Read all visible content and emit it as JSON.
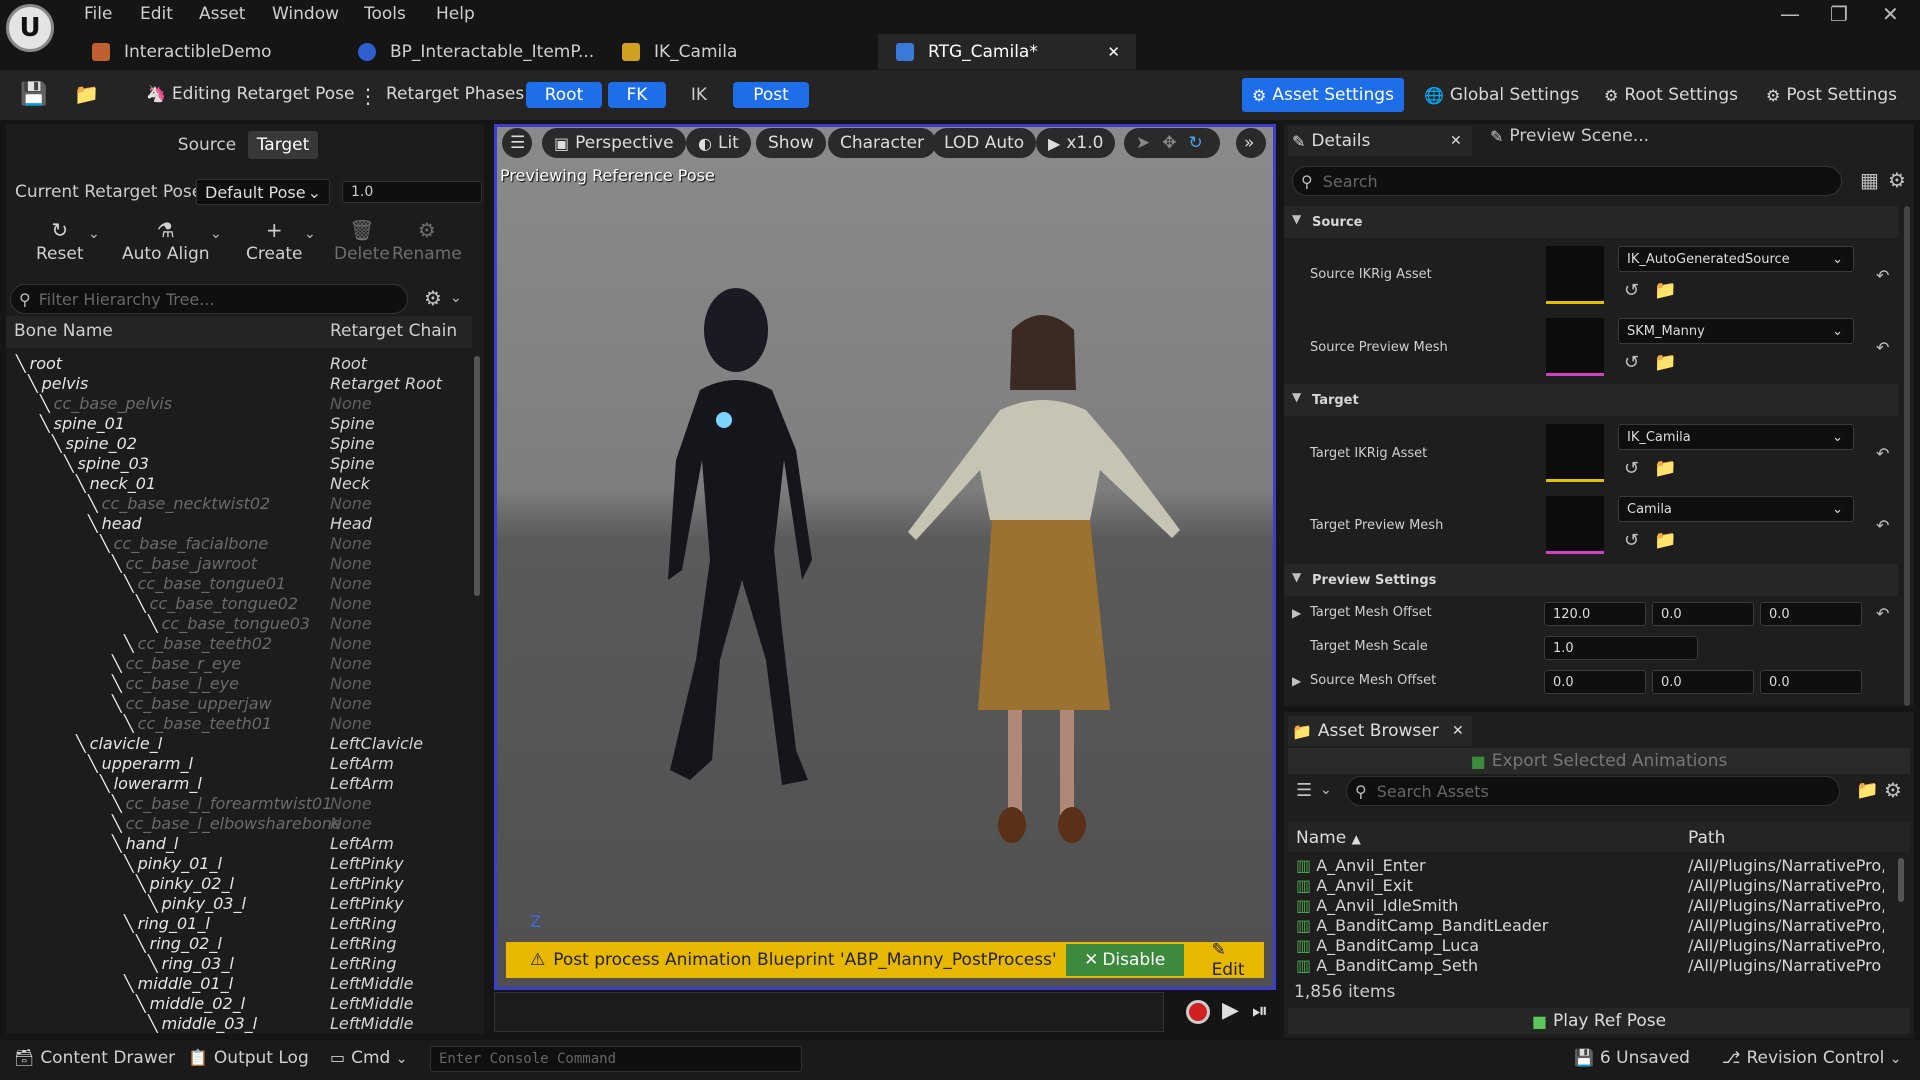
{
  "menu": {
    "file": "File",
    "edit": "Edit",
    "asset": "Asset",
    "window": "Window",
    "tools": "Tools",
    "help": "Help"
  },
  "tabs": [
    {
      "label": "InteractibleDemo",
      "color": "#c06030"
    },
    {
      "label": "BP_Interactable_ItemP...",
      "color": "#3060d0"
    },
    {
      "label": "IK_Camila",
      "color": "#d0a020"
    },
    {
      "label": "RTG_Camila*",
      "color": "#3a7ad8"
    }
  ],
  "toolbar": {
    "mode": "Editing Retarget Pose",
    "phases_label": "Retarget Phases:",
    "phases": [
      "Root",
      "FK",
      "IK",
      "Post"
    ],
    "asset_settings": "Asset Settings",
    "global_settings": "Global Settings",
    "root_settings": "Root Settings",
    "post_settings": "Post Settings"
  },
  "left": {
    "source_tab": "Source",
    "target_tab": "Target",
    "pose_label": "Current Retarget Pose:",
    "pose_value": "Default Pose",
    "blend_value": "1.0",
    "reset": "Reset",
    "auto_align": "Auto Align",
    "create": "Create",
    "delete": "Delete",
    "rename": "Rename",
    "filter_placeholder": "Filter Hierarchy Tree...",
    "col_bone": "Bone Name",
    "col_chain": "Retarget Chain",
    "bones": [
      {
        "name": "root",
        "chain": "Root",
        "depth": 0,
        "dim": false
      },
      {
        "name": "pelvis",
        "chain": "Retarget Root",
        "depth": 1,
        "dim": false
      },
      {
        "name": "cc_base_pelvis",
        "chain": "None",
        "depth": 2,
        "dim": true
      },
      {
        "name": "spine_01",
        "chain": "Spine",
        "depth": 2,
        "dim": false
      },
      {
        "name": "spine_02",
        "chain": "Spine",
        "depth": 3,
        "dim": false
      },
      {
        "name": "spine_03",
        "chain": "Spine",
        "depth": 4,
        "dim": false
      },
      {
        "name": "neck_01",
        "chain": "Neck",
        "depth": 5,
        "dim": false
      },
      {
        "name": "cc_base_necktwist02",
        "chain": "None",
        "depth": 6,
        "dim": true
      },
      {
        "name": "head",
        "chain": "Head",
        "depth": 6,
        "dim": false
      },
      {
        "name": "cc_base_facialbone",
        "chain": "None",
        "depth": 7,
        "dim": true
      },
      {
        "name": "cc_base_jawroot",
        "chain": "None",
        "depth": 8,
        "dim": true
      },
      {
        "name": "cc_base_tongue01",
        "chain": "None",
        "depth": 9,
        "dim": true
      },
      {
        "name": "cc_base_tongue02",
        "chain": "None",
        "depth": 10,
        "dim": true
      },
      {
        "name": "cc_base_tongue03",
        "chain": "None",
        "depth": 11,
        "dim": true
      },
      {
        "name": "cc_base_teeth02",
        "chain": "None",
        "depth": 9,
        "dim": true
      },
      {
        "name": "cc_base_r_eye",
        "chain": "None",
        "depth": 8,
        "dim": true
      },
      {
        "name": "cc_base_l_eye",
        "chain": "None",
        "depth": 8,
        "dim": true
      },
      {
        "name": "cc_base_upperjaw",
        "chain": "None",
        "depth": 8,
        "dim": true
      },
      {
        "name": "cc_base_teeth01",
        "chain": "None",
        "depth": 9,
        "dim": true
      },
      {
        "name": "clavicle_l",
        "chain": "LeftClavicle",
        "depth": 5,
        "dim": false
      },
      {
        "name": "upperarm_l",
        "chain": "LeftArm",
        "depth": 6,
        "dim": false
      },
      {
        "name": "lowerarm_l",
        "chain": "LeftArm",
        "depth": 7,
        "dim": false
      },
      {
        "name": "cc_base_l_forearmtwist01",
        "chain": "None",
        "depth": 8,
        "dim": true
      },
      {
        "name": "cc_base_l_elbowsharebone",
        "chain": "None",
        "depth": 8,
        "dim": true
      },
      {
        "name": "hand_l",
        "chain": "LeftArm",
        "depth": 8,
        "dim": false
      },
      {
        "name": "pinky_01_l",
        "chain": "LeftPinky",
        "depth": 9,
        "dim": false
      },
      {
        "name": "pinky_02_l",
        "chain": "LeftPinky",
        "depth": 10,
        "dim": false
      },
      {
        "name": "pinky_03_l",
        "chain": "LeftPinky",
        "depth": 11,
        "dim": false
      },
      {
        "name": "ring_01_l",
        "chain": "LeftRing",
        "depth": 9,
        "dim": false
      },
      {
        "name": "ring_02_l",
        "chain": "LeftRing",
        "depth": 10,
        "dim": false
      },
      {
        "name": "ring_03_l",
        "chain": "LeftRing",
        "depth": 11,
        "dim": false
      },
      {
        "name": "middle_01_l",
        "chain": "LeftMiddle",
        "depth": 9,
        "dim": false
      },
      {
        "name": "middle_02_l",
        "chain": "LeftMiddle",
        "depth": 10,
        "dim": false
      },
      {
        "name": "middle_03_l",
        "chain": "LeftMiddle",
        "depth": 11,
        "dim": false
      }
    ]
  },
  "viewport": {
    "perspective": "Perspective",
    "lit": "Lit",
    "show": "Show",
    "character": "Character",
    "lod": "LOD Auto",
    "speed": "x1.0",
    "overlay": "Previewing Reference Pose",
    "axis": "Z",
    "warning": "Post process Animation Blueprint 'ABP_Manny_PostProcess' i",
    "disable": "Disable",
    "edit": "Edit"
  },
  "details": {
    "tab": "Details",
    "tab2": "Preview Scene...",
    "search_placeholder": "Search",
    "source_header": "Source",
    "source_ikrig_label": "Source IKRig Asset",
    "source_ikrig_value": "IK_AutoGeneratedSource",
    "source_mesh_label": "Source Preview Mesh",
    "source_mesh_value": "SKM_Manny",
    "target_header": "Target",
    "target_ikrig_label": "Target IKRig Asset",
    "target_ikrig_value": "IK_Camila",
    "target_mesh_label": "Target Preview Mesh",
    "target_mesh_value": "Camila",
    "preview_header": "Preview Settings",
    "offset_label": "Target Mesh Offset",
    "offset": [
      "120.0",
      "0.0",
      "0.0"
    ],
    "scale_label": "Target Mesh Scale",
    "scale": "1.0",
    "src_offset_label": "Source Mesh Offset",
    "src_offset": [
      "0.0",
      "0.0",
      "0.0"
    ]
  },
  "assets": {
    "tab": "Asset Browser",
    "export": "Export Selected Animations",
    "search_placeholder": "Search Assets",
    "col_name": "Name",
    "col_path": "Path",
    "rows": [
      {
        "name": "A_Anvil_Enter",
        "path": "/All/Plugins/NarrativePro,"
      },
      {
        "name": "A_Anvil_Exit",
        "path": "/All/Plugins/NarrativePro,"
      },
      {
        "name": "A_Anvil_IdleSmith",
        "path": "/All/Plugins/NarrativePro,"
      },
      {
        "name": "A_BanditCamp_BanditLeader",
        "path": "/All/Plugins/NarrativePro,"
      },
      {
        "name": "A_BanditCamp_Luca",
        "path": "/All/Plugins/NarrativePro,"
      },
      {
        "name": "A_BanditCamp_Seth",
        "path": "/All/Plugins/NarrativePro"
      }
    ],
    "count": "1,856 items",
    "play": "Play Ref Pose"
  },
  "status": {
    "content_drawer": "Content Drawer",
    "output_log": "Output Log",
    "cmd": "Cmd",
    "console_placeholder": "Enter Console Command",
    "unsaved": "6 Unsaved",
    "revision": "Revision Control"
  },
  "colors": {
    "accent": "#1d6ee8",
    "warning": "#e8b800",
    "disable": "#3c8a3c",
    "viewport_border": "#3a3fd0"
  }
}
